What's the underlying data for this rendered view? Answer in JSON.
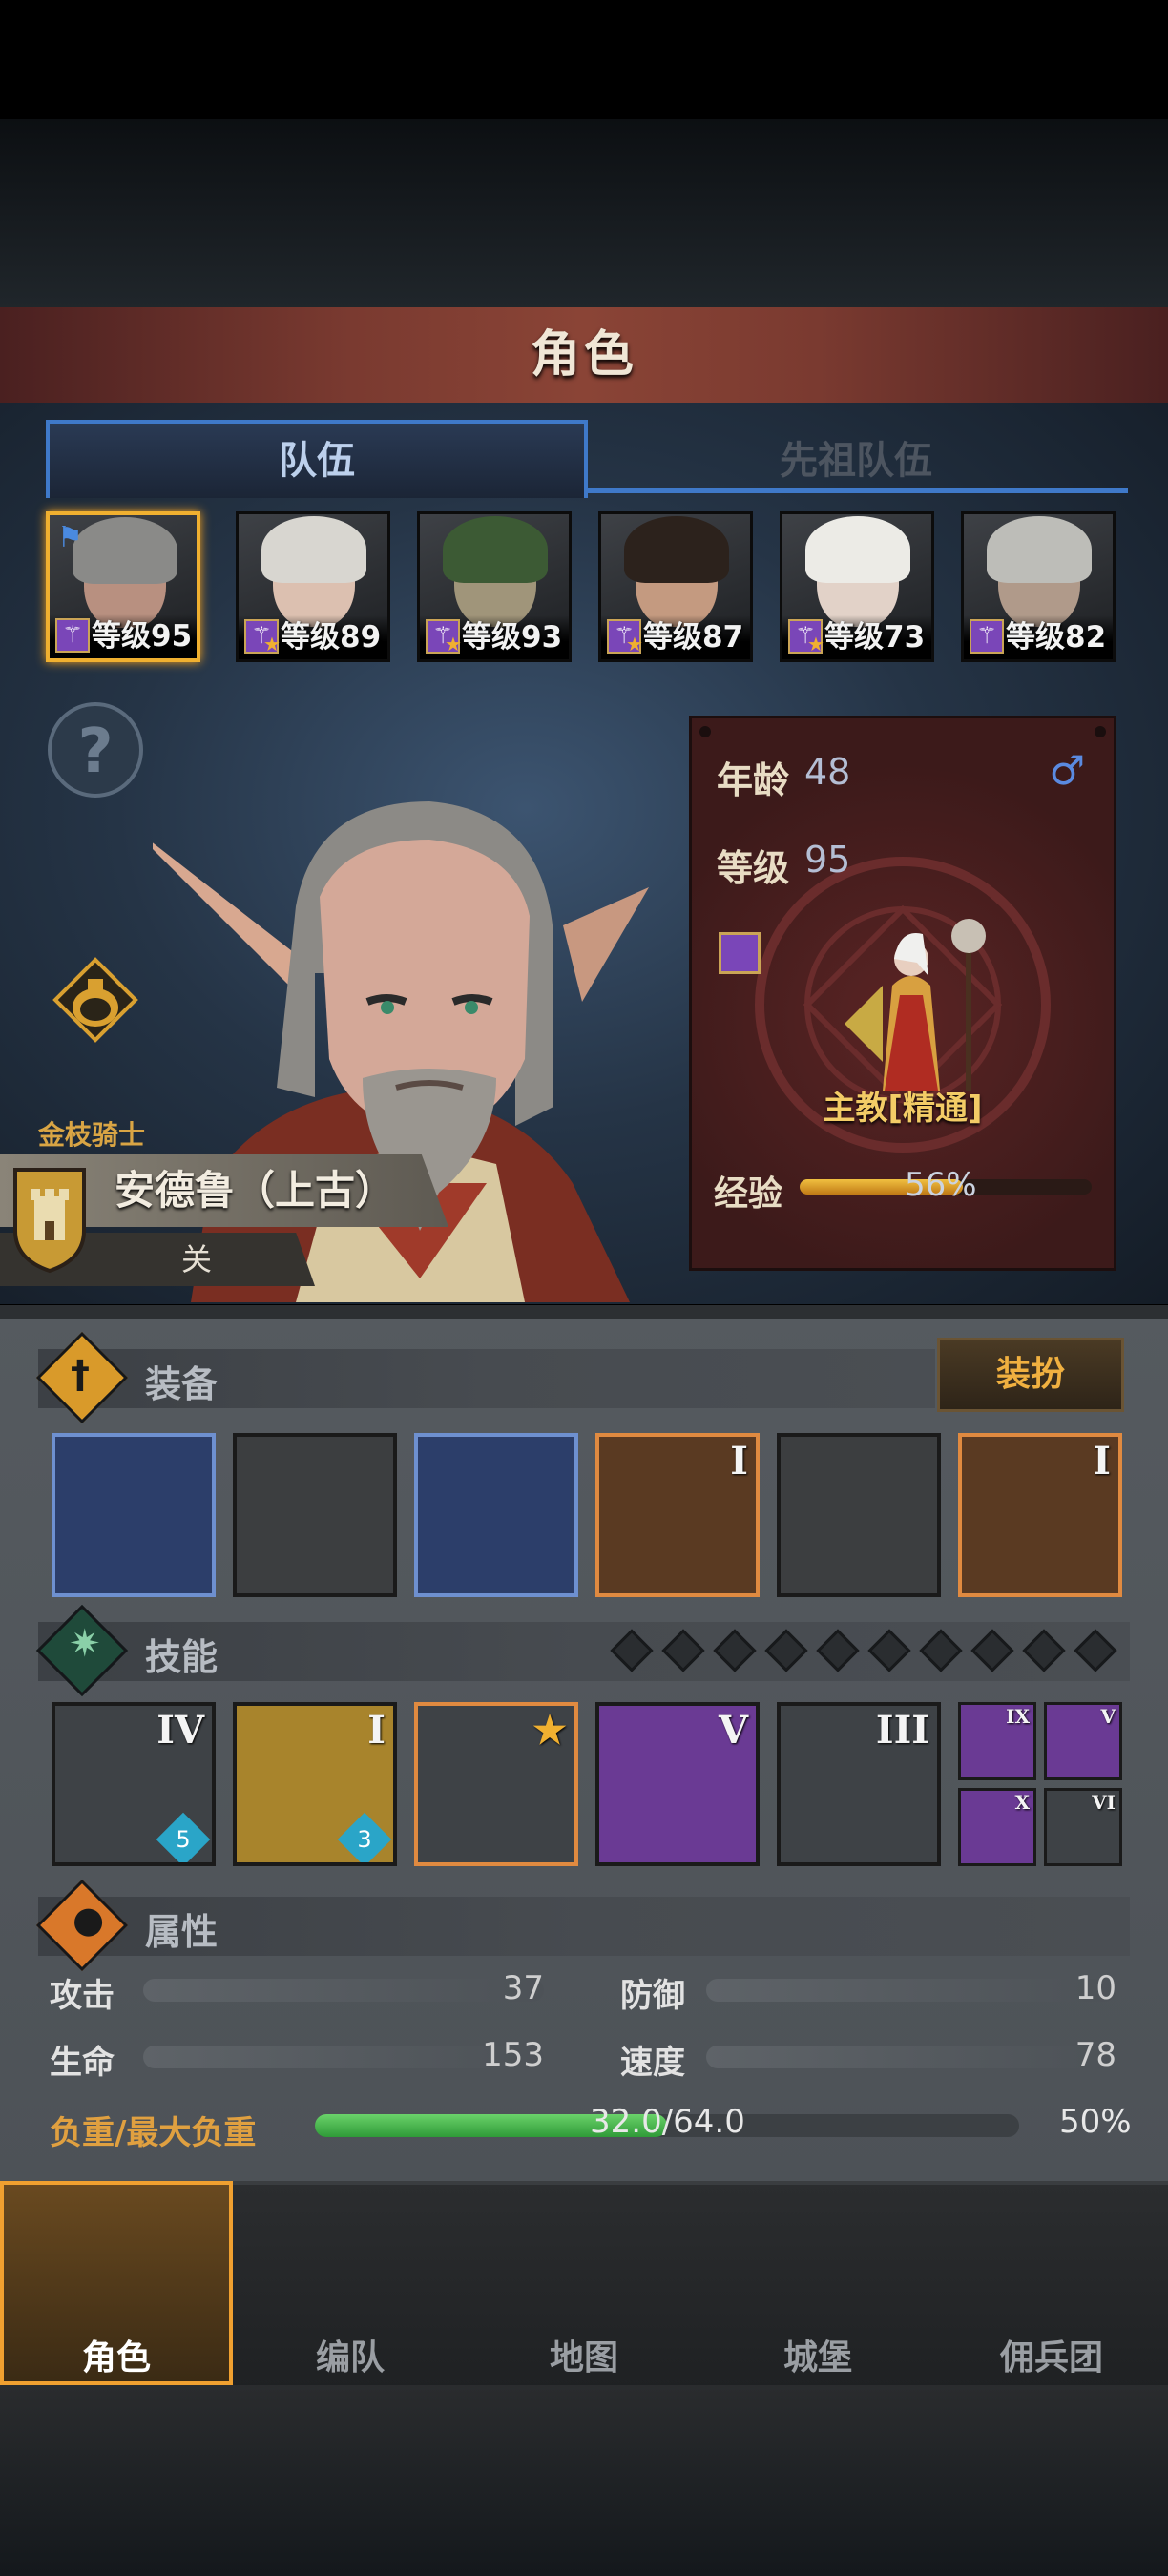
{
  "header": {
    "title": "角色"
  },
  "tabs": [
    {
      "label": "队伍",
      "active": true
    },
    {
      "label": "先祖队伍",
      "active": false
    }
  ],
  "roster": [
    {
      "level_text": "等级95",
      "selected": true,
      "has_flag": true,
      "star": false,
      "hair": "#8a8a88",
      "skin": "#b89080"
    },
    {
      "level_text": "等级89",
      "selected": false,
      "has_flag": false,
      "star": true,
      "hair": "#d8d6d0",
      "skin": "#dcc0b0"
    },
    {
      "level_text": "等级93",
      "selected": false,
      "has_flag": false,
      "star": true,
      "hair": "#3c5a34",
      "skin": "#a0957a"
    },
    {
      "level_text": "等级87",
      "selected": false,
      "has_flag": false,
      "star": true,
      "hair": "#2c221c",
      "skin": "#c49a80"
    },
    {
      "level_text": "等级73",
      "selected": false,
      "has_flag": false,
      "star": true,
      "hair": "#ecebe6",
      "skin": "#e2d2c8"
    },
    {
      "level_text": "等级82",
      "selected": false,
      "has_flag": false,
      "star": false,
      "hair": "#bdbdb8",
      "skin": "#b09a8a"
    }
  ],
  "help_icon": "?",
  "character": {
    "title_label": "金枝骑士",
    "name": "安德鲁（上古）",
    "subtitle": "关",
    "age_label": "年龄",
    "age": "48",
    "gender_symbol": "♂",
    "level_label": "等级",
    "level": "95",
    "class_name": "主教[精通]",
    "exp_label": "经验",
    "exp_percent_text": "56%",
    "exp_fraction": 0.56
  },
  "equipment": {
    "title": "装备",
    "dress_button": "装扮",
    "slots": [
      {
        "icon": "skull-staff-icon",
        "frame": "blue",
        "tier": ""
      },
      {
        "icon": "kite-shield-icon",
        "frame": "dark",
        "tier": ""
      },
      {
        "icon": "hood-icon",
        "frame": "blue",
        "tier": ""
      },
      {
        "icon": "robe-armor-icon",
        "frame": "orange",
        "tier": "I"
      },
      {
        "icon": "boots-icon",
        "frame": "dark",
        "tier": ""
      },
      {
        "icon": "tome-icon",
        "frame": "orange",
        "tier": "I"
      }
    ]
  },
  "skills": {
    "title": "技能",
    "pips": 10,
    "main": [
      {
        "icon": "spear-guard-skill-icon",
        "tier": "IV",
        "gem": "5",
        "bg": "#3e4246",
        "border": "#1a1a1a"
      },
      {
        "icon": "holy-shield-skill-icon",
        "tier": "I",
        "gem": "3",
        "bg": "#a8842c",
        "border": "#1a1a1a"
      },
      {
        "icon": "crystal-prayer-skill-icon",
        "tier": "★",
        "gem": "",
        "bg": "#3e4246",
        "border": "#e08a40"
      },
      {
        "icon": "crystal-hand-skill-icon",
        "tier": "V",
        "gem": "",
        "bg": "#6a3a94",
        "border": "#1a1a1a"
      },
      {
        "icon": "crystal-hand-gray-skill-icon",
        "tier": "III",
        "gem": "",
        "bg": "#3e4246",
        "border": "#1a1a1a"
      }
    ],
    "small": [
      {
        "icon": "staff-strike-skill-icon",
        "tier": "IX",
        "bg": "#6a3a94"
      },
      {
        "icon": "holy-burst-skill-icon",
        "tier": "V",
        "bg": "#6a3a94"
      },
      {
        "icon": "shatter-skill-icon",
        "tier": "X",
        "bg": "#6a3a94"
      },
      {
        "icon": "radiance-skill-icon",
        "tier": "VI",
        "bg": "#3e4246"
      }
    ]
  },
  "attributes": {
    "title": "属性",
    "stats": [
      {
        "label": "攻击",
        "value": "37"
      },
      {
        "label": "防御",
        "value": "10"
      },
      {
        "label": "生命",
        "value": "153"
      },
      {
        "label": "速度",
        "value": "78"
      }
    ],
    "load_label": "负重/最大负重",
    "load_text": "32.0/64.0",
    "load_percent": "50%",
    "load_fraction": 0.5
  },
  "nav": [
    {
      "label": "角色",
      "icon": "knight-helmet-icon",
      "selected": true
    },
    {
      "label": "编队",
      "icon": "armored-knight-icon",
      "selected": false
    },
    {
      "label": "地图",
      "icon": "compass-map-icon",
      "selected": false
    },
    {
      "label": "城堡",
      "icon": "castle-icon",
      "selected": false
    },
    {
      "label": "佣兵团",
      "icon": "mercenary-banner-icon",
      "selected": false
    }
  ],
  "colors": {
    "accent_gold": "#f0b030",
    "tab_blue": "#3f79c9",
    "info_panel": "#5a2424",
    "load_green": "#2f9a38"
  }
}
